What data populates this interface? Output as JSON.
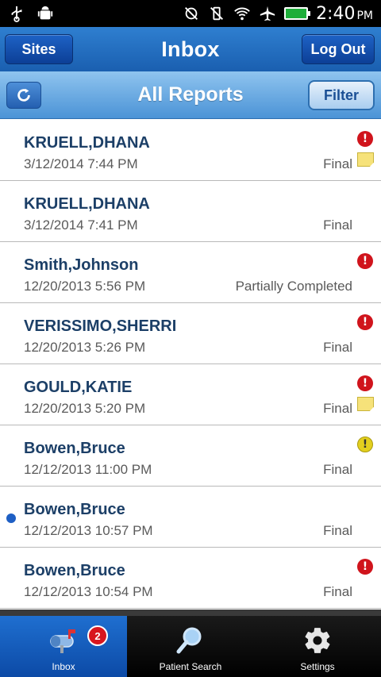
{
  "status_bar": {
    "time": "2:40",
    "ampm": "PM",
    "icons": [
      "usb-icon",
      "android-debug-icon",
      "no-sync-icon",
      "vibrate-icon",
      "wifi-icon",
      "airplane-icon",
      "battery-icon"
    ]
  },
  "header": {
    "title": "Inbox",
    "sites_label": "Sites",
    "logout_label": "Log Out"
  },
  "subheader": {
    "title": "All Reports",
    "filter_label": "Filter"
  },
  "reports": [
    {
      "name": "KRUELL,DHANA",
      "date": "3/12/2014 7:44 PM",
      "status": "Final",
      "priority": "high",
      "note": true,
      "unread": false
    },
    {
      "name": "KRUELL,DHANA",
      "date": "3/12/2014 7:41 PM",
      "status": "Final",
      "priority": "",
      "note": false,
      "unread": false
    },
    {
      "name": "Smith,Johnson",
      "date": "12/20/2013 5:56 PM",
      "status": "Partially Completed",
      "priority": "high",
      "note": false,
      "unread": false
    },
    {
      "name": "VERISSIMO,SHERRI",
      "date": "12/20/2013 5:26 PM",
      "status": "Final",
      "priority": "high",
      "note": false,
      "unread": false
    },
    {
      "name": "GOULD,KATIE",
      "date": "12/20/2013 5:20 PM",
      "status": "Final",
      "priority": "high",
      "note": true,
      "unread": false
    },
    {
      "name": "Bowen,Bruce",
      "date": "12/12/2013 11:00 PM",
      "status": "Final",
      "priority": "medium",
      "note": false,
      "unread": false
    },
    {
      "name": "Bowen,Bruce",
      "date": "12/12/2013 10:57 PM",
      "status": "Final",
      "priority": "",
      "note": false,
      "unread": true
    },
    {
      "name": "Bowen,Bruce",
      "date": "12/12/2013 10:54 PM",
      "status": "Final",
      "priority": "high",
      "note": false,
      "unread": false
    }
  ],
  "bottom_nav": {
    "inbox_label": "Inbox",
    "inbox_badge": "2",
    "patient_search_label": "Patient Search",
    "settings_label": "Settings"
  },
  "colors": {
    "header_blue": "#1a5fb0",
    "name_text": "#1c3f67",
    "priority_high": "#d0141c",
    "priority_medium": "#e3cf1e",
    "unread_dot": "#1e5fc4"
  }
}
